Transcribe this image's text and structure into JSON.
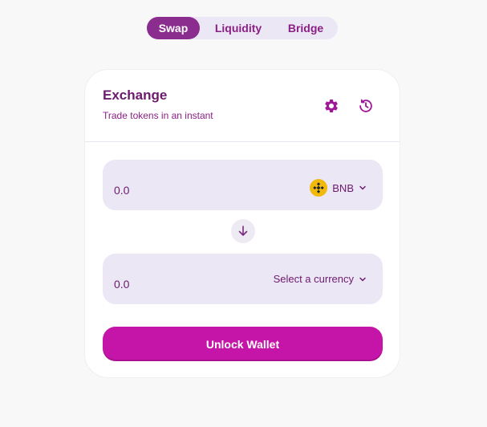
{
  "nav": {
    "tabs": [
      {
        "label": "Swap",
        "active": true
      },
      {
        "label": "Liquidity",
        "active": false
      },
      {
        "label": "Bridge",
        "active": false
      }
    ]
  },
  "exchange": {
    "title": "Exchange",
    "subtitle": "Trade tokens in an instant",
    "settings_icon": "gear-icon",
    "history_icon": "history-icon"
  },
  "from": {
    "amount": "0.0",
    "currency": "BNB",
    "currency_icon": "bnb-logo-icon"
  },
  "swap_icon": "arrow-down-icon",
  "to": {
    "amount": "0.0",
    "currency": "Select a currency"
  },
  "unlock_button": "Unlock Wallet",
  "colors": {
    "accent": "#c514a8",
    "tab_active": "#8b2c8f",
    "text": "#6b1a6e",
    "input_bg": "#ece7f5"
  }
}
